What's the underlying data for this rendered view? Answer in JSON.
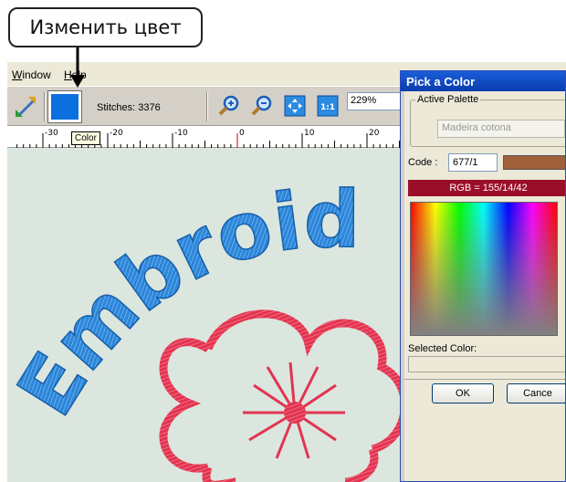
{
  "callout": {
    "text": "Изменить цвет"
  },
  "menu": {
    "items": [
      "Window",
      "Help"
    ]
  },
  "toolbar": {
    "stitches": "Stitches: 3376",
    "zoom_value": "229%",
    "current_color": "#0c6fe0"
  },
  "tooltip": {
    "text": "Color"
  },
  "ruler": {
    "labels": [
      "-30",
      "-20",
      "-10",
      "0",
      "10",
      "20"
    ]
  },
  "canvas": {
    "text": "Embroid"
  },
  "dialog": {
    "title": "Pick a Color",
    "group_label": "Active Palette",
    "palette_value": "Madeira cotona",
    "code_label": "Code :",
    "code_value": "677/1",
    "code_color": "#a0603a",
    "rgb_text": "RGB = 155/14/42",
    "rgb_color": "#9b0e2a",
    "selected_label": "Selected Color:",
    "ok_label": "OK",
    "cancel_label": "Cance"
  }
}
